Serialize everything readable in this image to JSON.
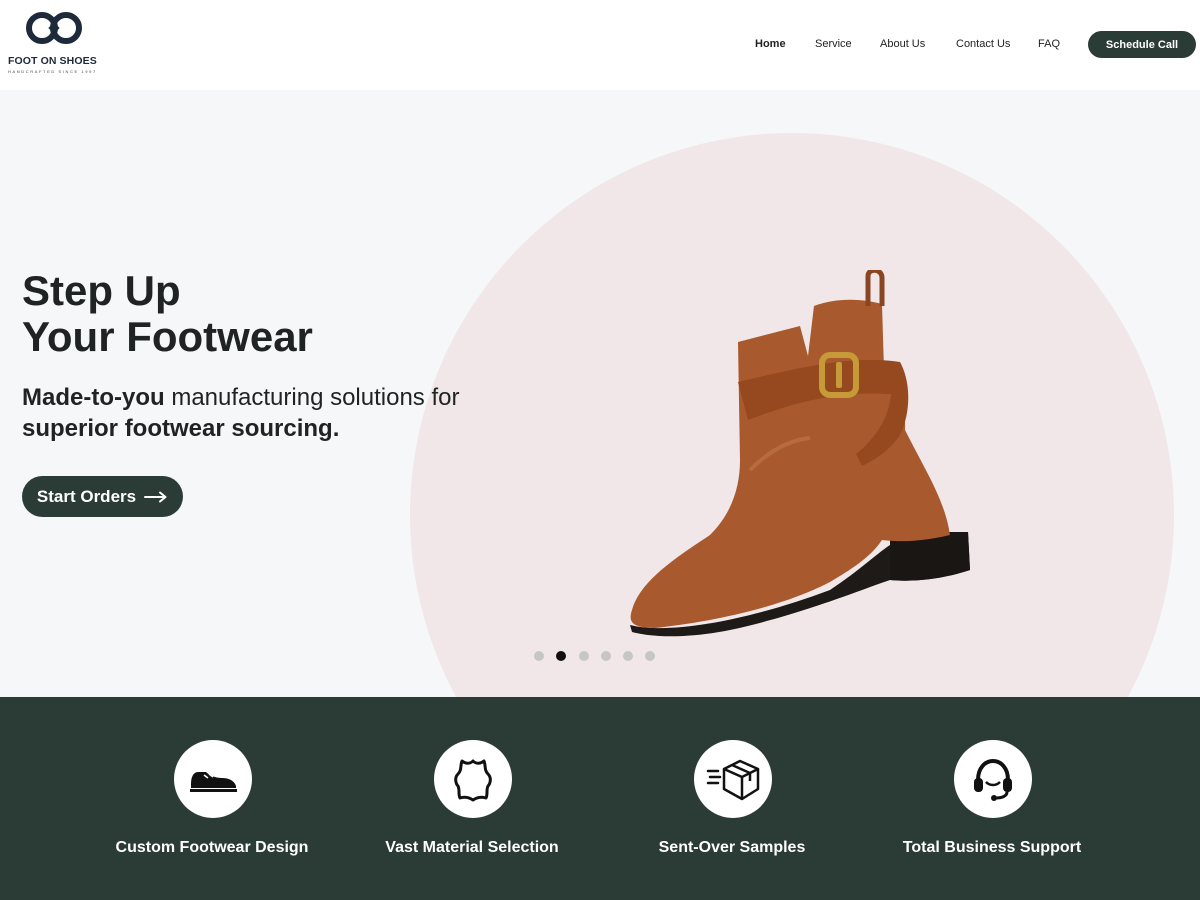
{
  "brand": {
    "name": "FOOT ON SHOES",
    "tagline": "HANDCRAFTED SINCE 1997"
  },
  "nav": {
    "items": [
      {
        "label": "Home",
        "active": true
      },
      {
        "label": "Service",
        "active": false
      },
      {
        "label": "About Us",
        "active": false
      },
      {
        "label": "Contact Us",
        "active": false
      },
      {
        "label": "FAQ",
        "active": false
      }
    ],
    "cta_label": "Schedule Call"
  },
  "hero": {
    "title_line1": "Step Up",
    "title_line2": "Your Footwear",
    "subtitle_bold": "Made-to-you",
    "subtitle_rest": " manufacturing solutions for",
    "subtitle_line2": "superior footwear sourcing.",
    "button_label": "Start Orders",
    "carousel": {
      "count": 6,
      "active_index": 1
    }
  },
  "features": [
    {
      "label": "Custom Footwear Design",
      "icon": "sneaker-icon"
    },
    {
      "label": "Vast Material Selection",
      "icon": "leather-hide-icon"
    },
    {
      "label": "Sent-Over Samples",
      "icon": "delivery-box-icon"
    },
    {
      "label": "Total Business Support",
      "icon": "headset-icon"
    }
  ],
  "colors": {
    "primary": "#2b3b36",
    "hero_bg": "#f5f7f9",
    "circle": "#f1e7e8",
    "boot": "#a85a2e"
  }
}
